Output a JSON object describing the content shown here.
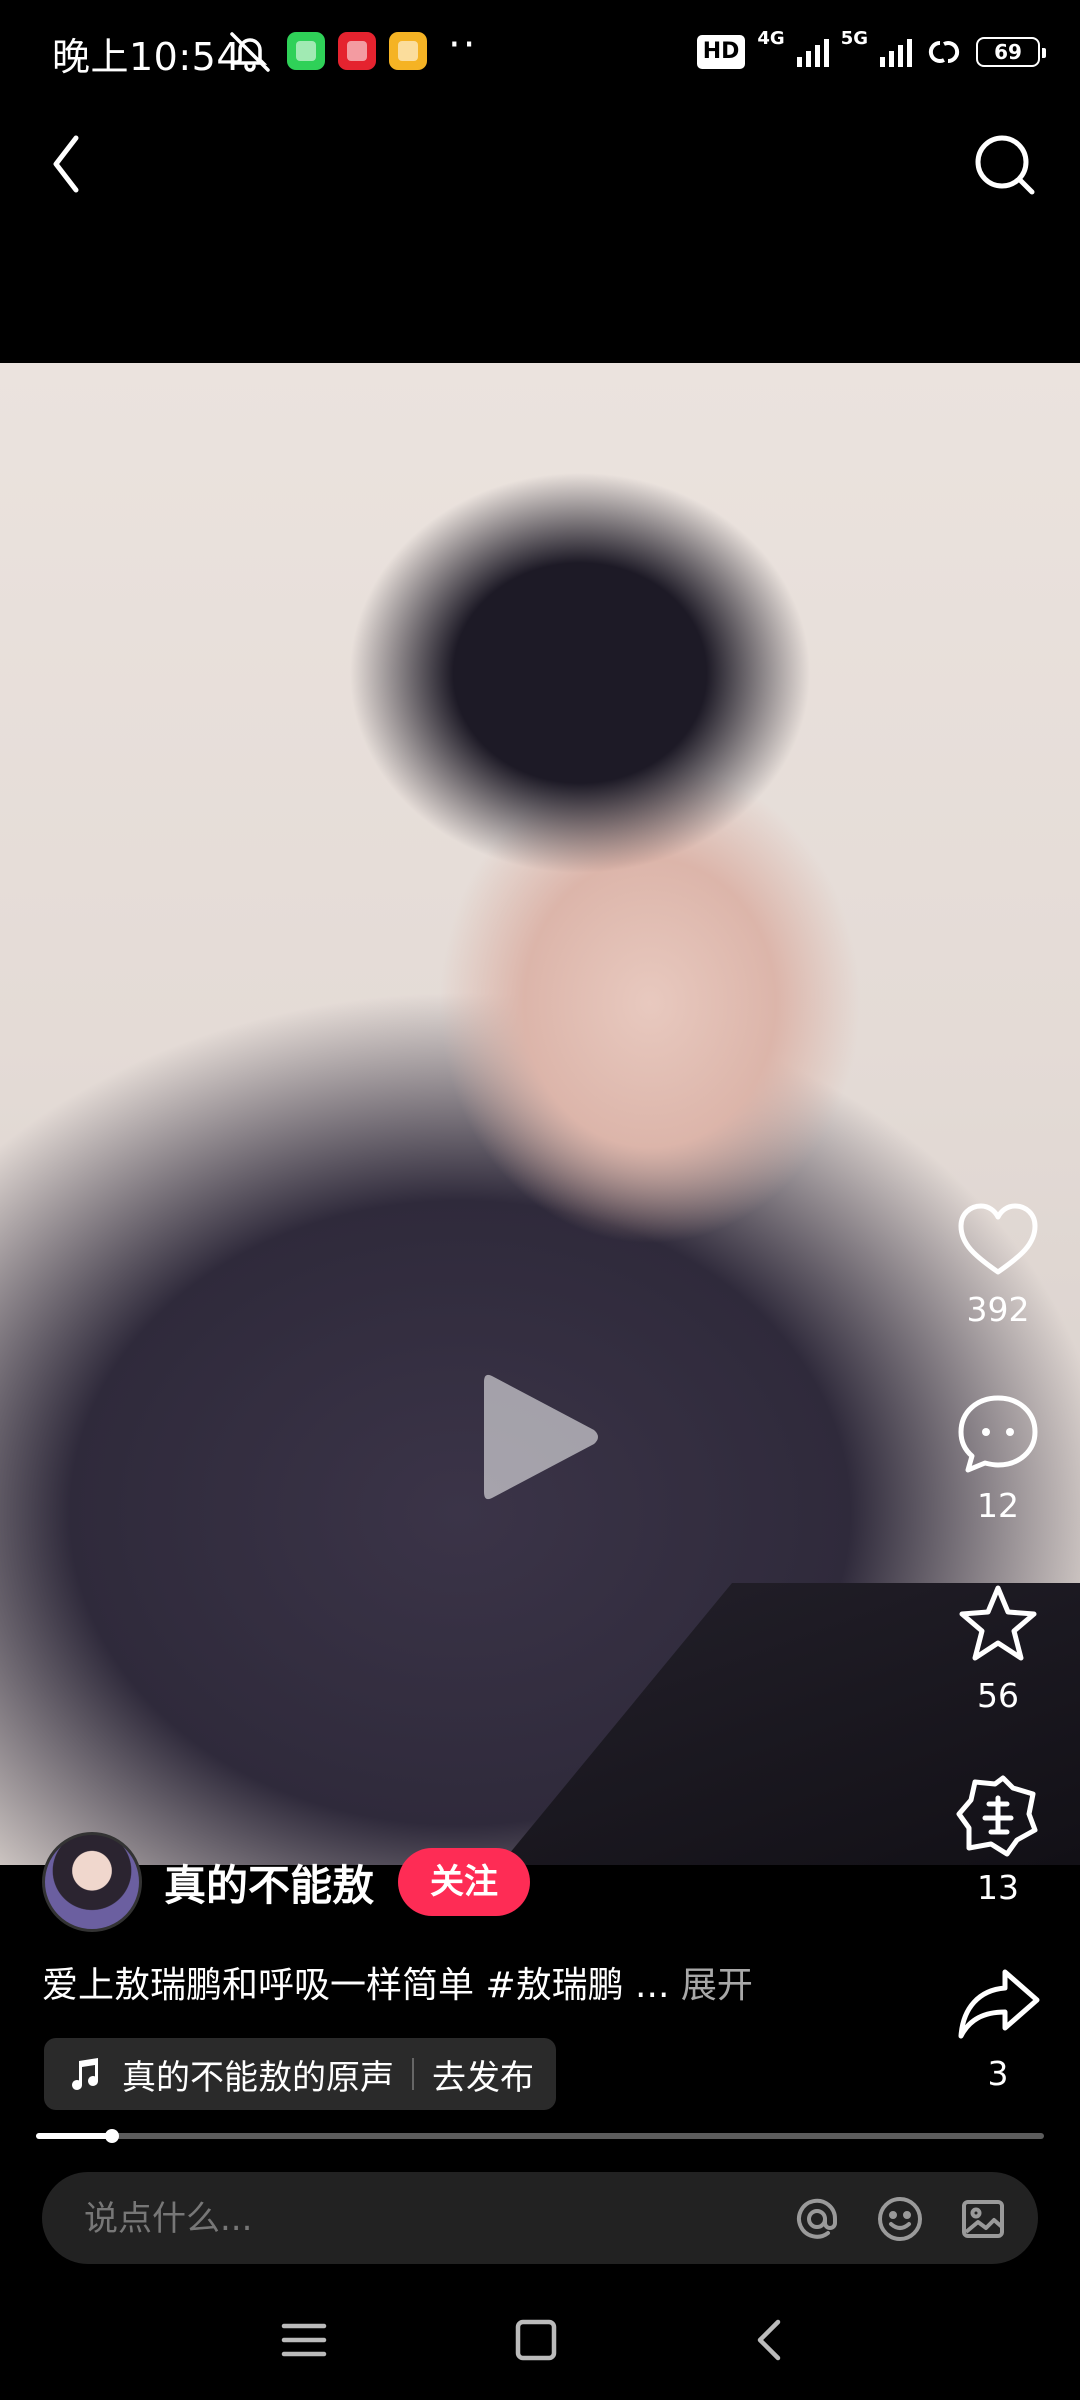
{
  "status_bar": {
    "time": "晚上10:54",
    "hd": "HD",
    "net1": "4G",
    "net2": "5G",
    "battery": "69",
    "more": "··"
  },
  "top_nav": {
    "back_icon": "chevron-left-icon",
    "search_icon": "search-icon"
  },
  "video": {
    "play_icon": "play-icon"
  },
  "actions": {
    "like_count": "392",
    "comment_count": "12",
    "favorite_count": "56",
    "tuan_count": "13",
    "share_count": "3"
  },
  "author": {
    "name": "真的不能敖",
    "follow_label": "关注"
  },
  "caption": {
    "text": "爱上敖瑞鹏和呼吸一样简单 #敖瑞鹏 ...",
    "expand_label": "展开"
  },
  "music": {
    "sound_name": "真的不能敖的原声",
    "publish_label": "去发布"
  },
  "progress": {
    "fraction": 0.075
  },
  "comment_bar": {
    "placeholder": "说点什么..."
  },
  "colors": {
    "follow_button": "#fe2c55",
    "background": "#000000"
  }
}
